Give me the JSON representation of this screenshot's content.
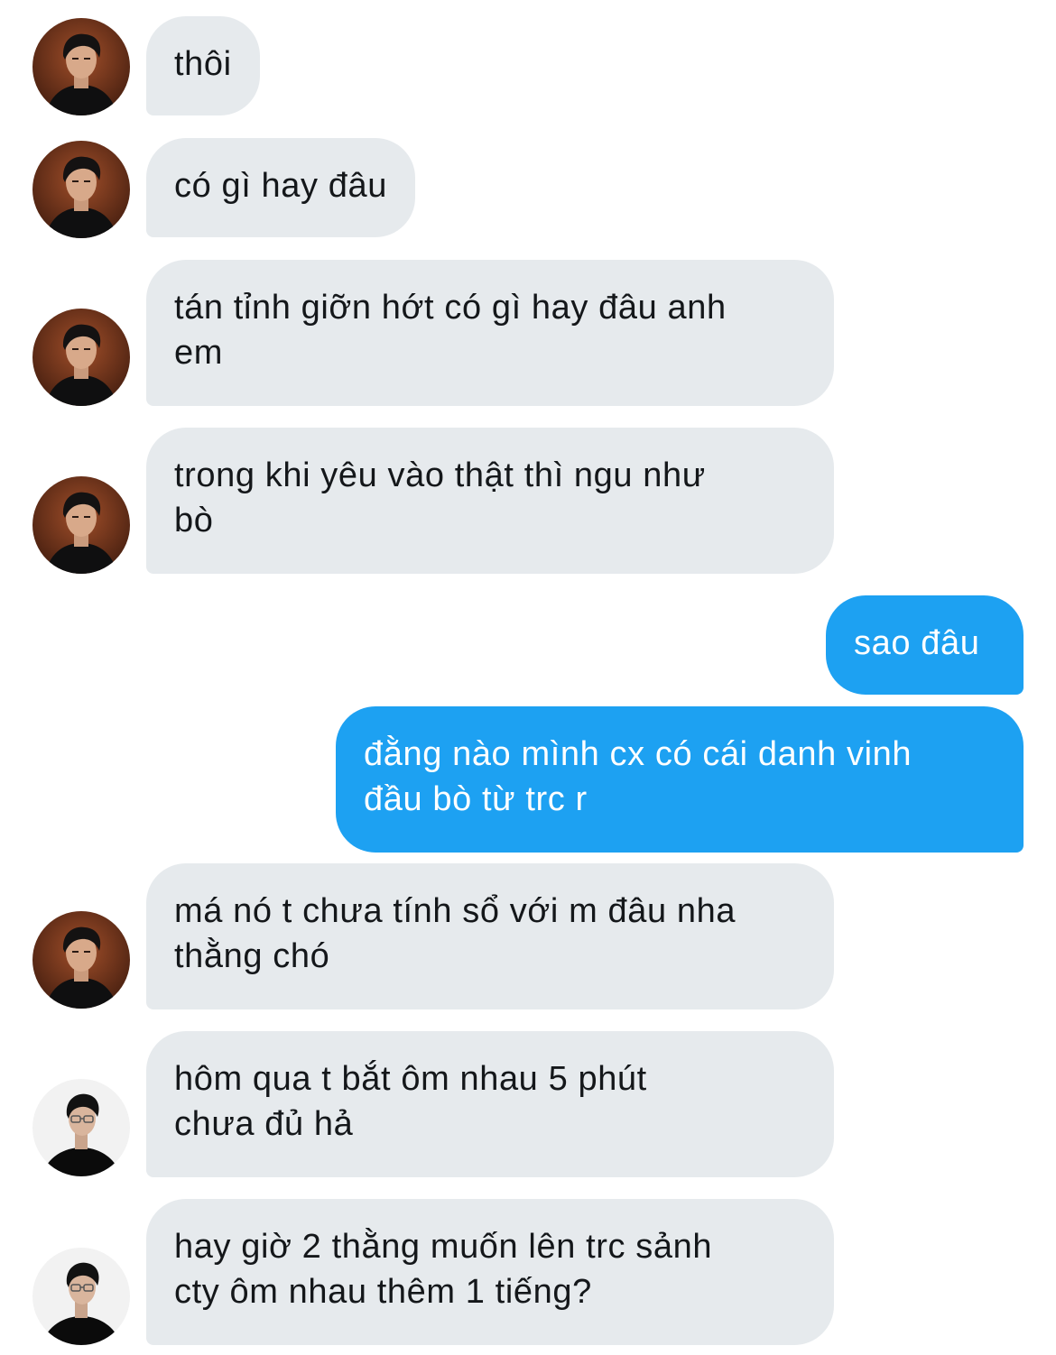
{
  "messages": [
    {
      "sender": "other",
      "avatar": "portrait-dark",
      "text": "thôi"
    },
    {
      "sender": "other",
      "avatar": "portrait-dark",
      "text": "có gì hay đâu"
    },
    {
      "sender": "other",
      "avatar": "portrait-dark",
      "text": "tán tỉnh giỡn hớt có gì hay đâu anh\nem"
    },
    {
      "sender": "other",
      "avatar": "portrait-dark",
      "text": "trong khi yêu vào thật thì ngu như\nbò"
    },
    {
      "sender": "me",
      "text": "sao đâu"
    },
    {
      "sender": "me",
      "text": "đằng nào mình cx có cái danh vinh\nđầu bò từ trc r"
    },
    {
      "sender": "other",
      "avatar": "portrait-dark",
      "text": "má nó t chưa tính sổ với m đâu nha\nthằng chó"
    },
    {
      "sender": "other",
      "avatar": "portrait-light",
      "text": "hôm qua t bắt ôm nhau 5 phút\nchưa đủ hả"
    },
    {
      "sender": "other",
      "avatar": "portrait-light",
      "text": "hay giờ 2 thằng muốn lên trc sảnh\ncty ôm nhau thêm 1 tiếng?"
    }
  ],
  "colors": {
    "incoming_bubble": "#e6eaed",
    "incoming_text": "#14171a",
    "outgoing_bubble": "#1da1f2",
    "outgoing_text": "#ffffff"
  }
}
